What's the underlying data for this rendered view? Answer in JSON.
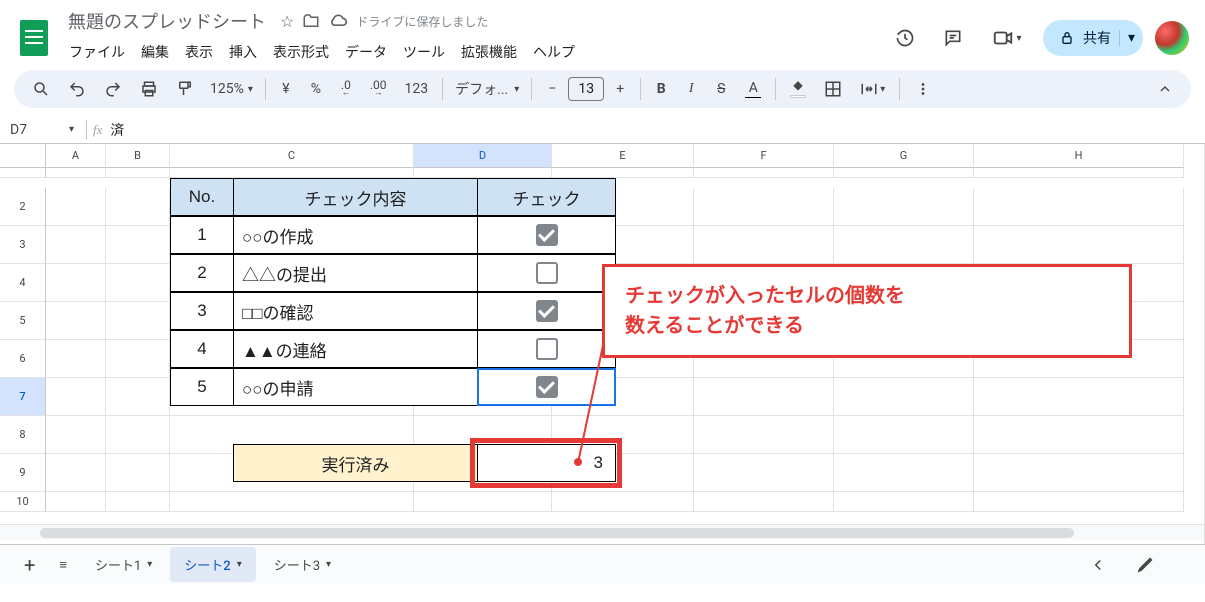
{
  "doc": {
    "title": "無題のスプレッドシート",
    "save_status": "ドライブに保存しました"
  },
  "menus": [
    "ファイル",
    "編集",
    "表示",
    "挿入",
    "表示形式",
    "データ",
    "ツール",
    "拡張機能",
    "ヘルプ"
  ],
  "share_label": "共有",
  "toolbar": {
    "zoom": "125%",
    "currency": "¥",
    "percent": "%",
    "dec_dec": ".0",
    "inc_dec": ".00",
    "num_fmt": "123",
    "font": "デフォ...",
    "font_size": "13"
  },
  "formula": {
    "cell_ref": "D7",
    "fx": "fx",
    "value": "済"
  },
  "grid": {
    "cols": [
      "A",
      "B",
      "C",
      "D",
      "E",
      "F",
      "G",
      "H"
    ],
    "sel_col": "D",
    "rows": [
      "",
      "2",
      "3",
      "4",
      "5",
      "6",
      "7",
      "8",
      "9",
      "10"
    ],
    "sel_row": "7"
  },
  "table": {
    "h_no": "No.",
    "h_content": "チェック内容",
    "h_check": "チェック",
    "rows": [
      {
        "no": "1",
        "content": "○○の作成",
        "checked": true
      },
      {
        "no": "2",
        "content": "△△の提出",
        "checked": false
      },
      {
        "no": "3",
        "content": "□□の確認",
        "checked": true
      },
      {
        "no": "4",
        "content": "▲▲の連絡",
        "checked": false
      },
      {
        "no": "5",
        "content": "○○の申請",
        "checked": true
      }
    ],
    "sum_label": "実行済み",
    "sum_value": "3"
  },
  "callout": {
    "line1": "チェックが入ったセルの個数を",
    "line2": "数えることができる"
  },
  "sheets": {
    "items": [
      "シート1",
      "シート2",
      "シート3"
    ],
    "active": 1
  }
}
